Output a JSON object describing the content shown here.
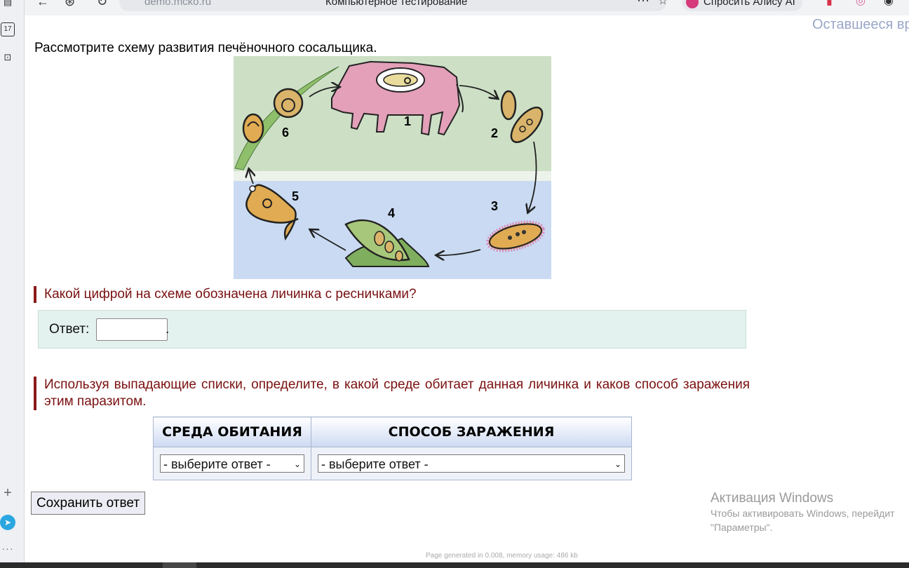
{
  "browser": {
    "url": "demo.mcko.ru",
    "tab_title": "Компьютерное тестирование",
    "alice_label": "Спросить Алису AI",
    "calendar_badge": "17"
  },
  "timer_label": "Оставшееся вр",
  "instruction": "Рассмотрите схему развития печёночного сосальщика.",
  "diagram_numbers": [
    "1",
    "2",
    "3",
    "4",
    "5",
    "6"
  ],
  "question1": "Какой цифрой на схеме обозначена личинка с ресничками?",
  "answer": {
    "label": "Ответ:",
    "value": "",
    "suffix": "."
  },
  "question2": "Используя выпадающие списки, определите, в какой среде обитает данная личинка и каков способ заражения этим паразитом.",
  "table": {
    "headers": [
      "СРЕДА ОБИТАНИЯ",
      "СПОСОБ ЗАРАЖЕНИЯ"
    ],
    "select1": "- выберите ответ -",
    "select2": "- выберите ответ -"
  },
  "save_label": "Сохранить ответ",
  "windows_activation": {
    "title": "Активация Windows",
    "line1": "Чтобы активировать Windows, перейдит",
    "line2": "\"Параметры\"."
  },
  "footer": "Page generated in 0.008, memory usage: 486 kb",
  "colors": {
    "question_text": "#7a1010",
    "answer_bg": "#e3f1ef",
    "header_grad": "#cdd9f2",
    "land_bg": "#cde0c6",
    "water_bg": "#c9daf2"
  }
}
